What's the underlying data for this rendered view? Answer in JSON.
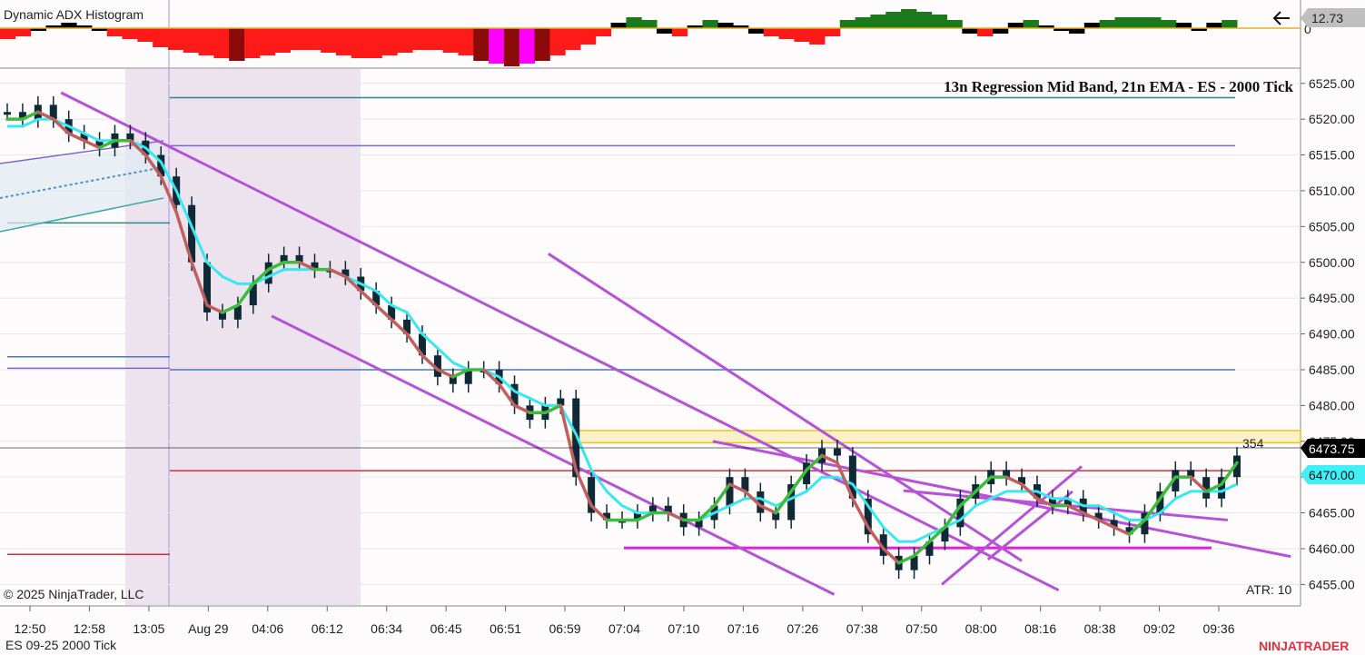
{
  "header": {
    "indicator_title": "Dynamic ADX Histogram",
    "indicator_value": "12.73",
    "indicator_zero": "0",
    "chart_title": "13n Regression Mid Band, 21n EMA - ES - 2000 Tick",
    "copyright": "© 2025 NinjaTrader, LLC",
    "instrument": "ES 09-25 2000 Tick",
    "atr": "ATR: 10",
    "bar_countdown": "354",
    "brand": "NINJATRADER"
  },
  "price_labels": {
    "last": "6473.75",
    "ema": "6470.00"
  },
  "colors": {
    "background": "#fdfbfb",
    "candle": "#0f2a36",
    "regression_up": "#3dbb3d",
    "regression_down": "#c0605e",
    "ema": "#38e8f0",
    "trendline": "#b652d8",
    "support": "#e020d8",
    "adx_strong_bear": "#ff1a1a",
    "adx_weak_bear": "#8b0a0a",
    "adx_bull": "#1a7a1a",
    "adx_neutral": "#000000",
    "session_shade": "#ede3ee",
    "last_price_box": "#000000",
    "ema_box": "#3ff0f7"
  },
  "chart_data": {
    "type": "line",
    "x": [
      "12:50",
      "12:58",
      "13:05",
      "Aug 29",
      "04:06",
      "06:12",
      "06:34",
      "06:45",
      "06:51",
      "06:59",
      "07:04",
      "07:10",
      "07:16",
      "07:26",
      "07:38",
      "07:50",
      "08:00",
      "08:16",
      "08:38",
      "09:02",
      "09:36"
    ],
    "ylim": [
      6452,
      6527
    ],
    "y_ticks": [
      6525,
      6520,
      6515,
      6510,
      6505,
      6500,
      6495,
      6490,
      6485,
      6480,
      6475,
      6470,
      6465,
      6460,
      6455
    ],
    "y_tick_labels": [
      "6525.00",
      "6520.00",
      "6515.00",
      "6510.00",
      "6505.00",
      "6500.00",
      "6495.00",
      "6490.00",
      "6485.00",
      "6480.00",
      "6475.00",
      "6470.00",
      "6465.00",
      "6460.00",
      "6455.00"
    ],
    "close": [
      6521,
      6520,
      6522,
      6520,
      6518,
      6517,
      6516,
      6518,
      6517,
      6515,
      6512,
      6508,
      6500,
      6493,
      6492,
      6494,
      6497,
      6500,
      6501,
      6500,
      6499,
      6499,
      6498,
      6496,
      6494,
      6492,
      6490,
      6487,
      6484,
      6483,
      6485,
      6485,
      6483,
      6480,
      6478,
      6480,
      6481,
      6470,
      6465,
      6464,
      6464,
      6465,
      6466,
      6465,
      6463,
      6464,
      6466,
      6470,
      6468,
      6465,
      6464,
      6469,
      6472,
      6474,
      6473,
      6467,
      6462,
      6459,
      6457,
      6459,
      6461,
      6463,
      6467,
      6469,
      6471,
      6470,
      6469,
      6467,
      6466,
      6467,
      6465,
      6464,
      6463,
      6462,
      6465,
      6468,
      6471,
      6470,
      6467,
      6470,
      6473
    ],
    "series": [
      {
        "name": "",
        "values": [
          6520,
          6520,
          6521,
          6520,
          6518,
          6517,
          6516,
          6517,
          6517,
          6515,
          6512,
          6507,
          6500,
          6494,
          6493,
          6494,
          6497,
          6499,
          6500,
          6500,
          6499,
          6499,
          6498,
          6496,
          6494,
          6492,
          6490,
          6487,
          6485,
          6484,
          6485,
          6485,
          6483,
          6480,
          6479,
          6479,
          6480,
          6471,
          6466,
          6464,
          6464,
          6464,
          6465,
          6465,
          6464,
          6464,
          6466,
          6469,
          6468,
          6466,
          6465,
          6468,
          6471,
          6473,
          6472,
          6467,
          6463,
          6460,
          6458,
          6459,
          6461,
          6463,
          6466,
          6468,
          6470,
          6470,
          6469,
          6467,
          6466,
          6466,
          6465,
          6464,
          6463,
          6462,
          6464,
          6467,
          6470,
          6470,
          6468,
          6469,
          6472
        ]
      },
      {
        "name": "",
        "values": [
          6519,
          6519,
          6520,
          6520,
          6519,
          6518,
          6517,
          6517,
          6517,
          6516,
          6514,
          6510,
          6505,
          6500,
          6498,
          6497,
          6497,
          6498,
          6499,
          6499,
          6499,
          6499,
          6498,
          6497,
          6496,
          6494,
          6493,
          6490,
          6488,
          6486,
          6485,
          6485,
          6484,
          6482,
          6481,
          6480,
          6480,
          6476,
          6471,
          6468,
          6466,
          6465,
          6465,
          6465,
          6464,
          6464,
          6465,
          6466,
          6467,
          6467,
          6466,
          6467,
          6468,
          6470,
          6470,
          6469,
          6466,
          6463,
          6461,
          6461,
          6462,
          6463,
          6464,
          6466,
          6467,
          6468,
          6468,
          6468,
          6467,
          6467,
          6466,
          6466,
          6465,
          6464,
          6464,
          6465,
          6467,
          6468,
          6468,
          6468,
          6469
        ]
      }
    ],
    "levels": [
      6523,
      6516.3,
      6485,
      6470.9,
      6460.1
    ],
    "adx_histogram": [
      -4,
      -3,
      -1,
      1,
      2,
      1,
      -1,
      -3,
      -4,
      -5,
      -7,
      -8,
      -9,
      -10,
      -11,
      -12,
      -11,
      -10,
      -9,
      -8,
      -8,
      -9,
      -10,
      -11,
      -11,
      -10,
      -9,
      -8,
      -8,
      -9,
      -10,
      -12,
      -13,
      -14,
      -13,
      -12,
      -10,
      -8,
      -6,
      -3,
      2,
      4,
      3,
      -2,
      -3,
      1,
      3,
      2,
      1,
      -2,
      -3,
      -4,
      -5,
      -6,
      -3,
      3,
      4,
      5,
      6,
      7,
      6,
      5,
      3,
      -2,
      -3,
      -2,
      2,
      3,
      1,
      -1,
      -2,
      2,
      3,
      4,
      4,
      4,
      3,
      2,
      -1,
      2,
      3
    ]
  }
}
